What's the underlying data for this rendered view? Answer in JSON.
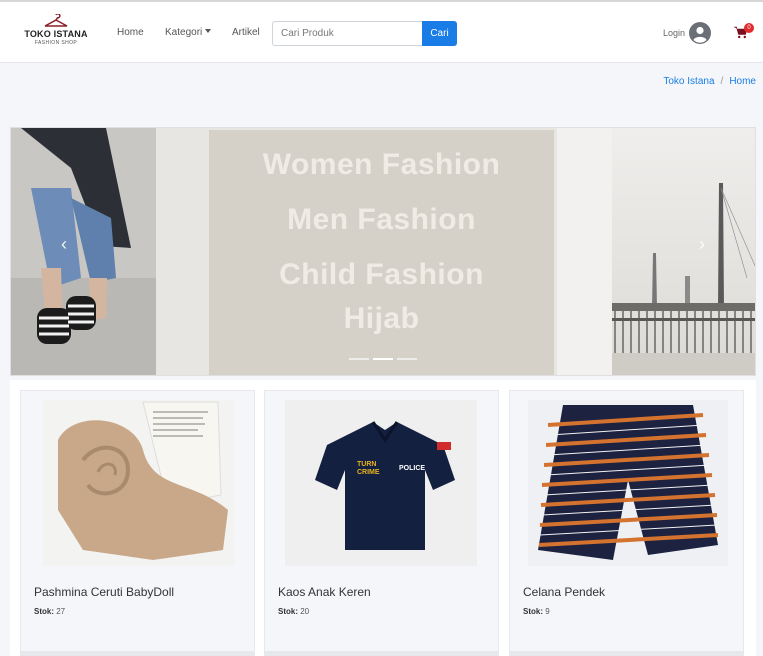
{
  "brand": {
    "name": "TOKO ISTANA",
    "tagline": "FASHION SHOP",
    "icon": "hanger-icon"
  },
  "nav": {
    "home": "Home",
    "kategori": "Kategori",
    "artikel": "Artikel"
  },
  "search": {
    "placeholder": "Cari Produk",
    "button": "Cari"
  },
  "account": {
    "login_label": "Login",
    "cart_count": "0"
  },
  "breadcrumb": {
    "items": [
      "Toko Istana",
      "Home"
    ],
    "separator": "/"
  },
  "carousel": {
    "lines": [
      "Women Fashion",
      "Men Fashion",
      "Child Fashion",
      "Hijab"
    ],
    "indicators": 3,
    "active_index": 1
  },
  "products": [
    {
      "name": "Pashmina Ceruti BabyDoll",
      "stock_label": "Stok:",
      "stock": "27"
    },
    {
      "name": "Kaos Anak Keren",
      "stock_label": "Stok:",
      "stock": "20"
    },
    {
      "name": "Celana Pendek",
      "stock_label": "Stok:",
      "stock": "9"
    }
  ],
  "colors": {
    "primary": "#1a7ce6",
    "badge": "#e02b2b",
    "background": "#f4f6fa"
  }
}
